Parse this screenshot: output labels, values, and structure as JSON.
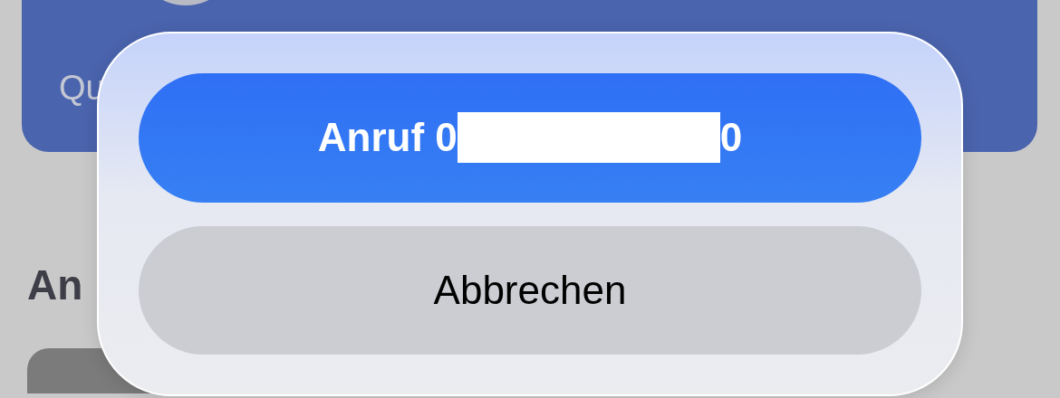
{
  "background": {
    "card_text": "Qu",
    "heading": "An"
  },
  "action_sheet": {
    "buttons": [
      {
        "kind": "primary",
        "label_start": "Anruf 0",
        "redacted": true,
        "label_end": "0"
      },
      {
        "kind": "cancel",
        "label_start": "Abbrechen",
        "redacted": false
      }
    ]
  }
}
